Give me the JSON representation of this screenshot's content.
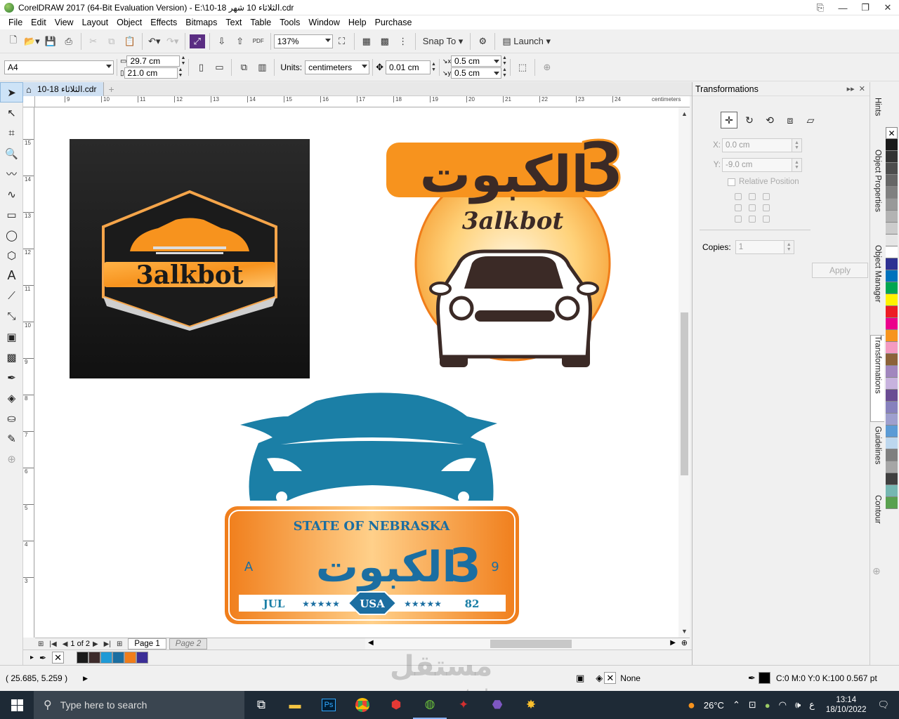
{
  "window": {
    "title": "CorelDRAW 2017 (64-Bit Evaluation Version) - E:\\10-18 الثلاثاء 10 شهر.cdr"
  },
  "menu": [
    "File",
    "Edit",
    "View",
    "Layout",
    "Object",
    "Effects",
    "Bitmaps",
    "Text",
    "Table",
    "Tools",
    "Window",
    "Help",
    "Purchase"
  ],
  "toolbar": {
    "zoom": "137%",
    "snap_to": "Snap To",
    "launch": "Launch"
  },
  "property_bar": {
    "page_size": "A4",
    "width": "29.7 cm",
    "height": "21.0 cm",
    "units_label": "Units:",
    "units": "centimeters",
    "nudge": "0.01 cm",
    "dup_x": "0.5 cm",
    "dup_y": "0.5 cm"
  },
  "document_tab": "10-18 الثلاثاء.cdr",
  "ruler": {
    "h_ticks": [
      "9",
      "10",
      "11",
      "12",
      "13",
      "14",
      "15",
      "16",
      "17",
      "18",
      "19",
      "20",
      "21",
      "22",
      "23",
      "24"
    ],
    "h_unit": "centimeters",
    "v_ticks": [
      "15",
      "14",
      "13",
      "12",
      "11",
      "10",
      "9",
      "8",
      "7",
      "6",
      "5",
      "4",
      "3"
    ]
  },
  "page_nav": {
    "current": "1",
    "of_label": "of",
    "total": "2",
    "tabs": [
      "Page 1",
      "Page 2"
    ]
  },
  "canvas": {
    "logo1": {
      "text": "3alkbot"
    },
    "logo2": {
      "arabic": "الكبوت",
      "digit": "3",
      "latin": "3alkbot"
    },
    "logo3": {
      "state": "STATE OF NEBRASKA",
      "arabic": "الكبوت",
      "digit": "3",
      "left_letter": "A",
      "right_digit": "9",
      "month": "JUL",
      "country": "USA",
      "year": "82",
      "stars": "★★★★★"
    }
  },
  "docker": {
    "title": "Transformations",
    "x_label": "X:",
    "x_value": "0.0 cm",
    "y_label": "Y:",
    "y_value": "-9.0 cm",
    "relative_position": "Relative Position",
    "copies_label": "Copies:",
    "copies_value": "1",
    "apply": "Apply",
    "tabs": [
      "Hints",
      "Object Properties",
      "Object Manager",
      "Transformations",
      "Guidelines",
      "Contour"
    ]
  },
  "palette_colors": [
    "#1a1a1a",
    "#333333",
    "#4d4d4d",
    "#666666",
    "#808080",
    "#999999",
    "#b3b3b3",
    "#cccccc",
    "#e6e6e6",
    "#ffffff",
    "#2e3192",
    "#0072bc",
    "#00a651",
    "#fff200",
    "#ed1c24",
    "#ec008c",
    "#f7941d",
    "#f49ac1",
    "#8c6239",
    "#a186be",
    "#c7b2de",
    "#6a4c93",
    "#8781bd",
    "#9e9fce",
    "#5b9bd5",
    "#bdd7ee",
    "#7f7f7f",
    "#a6a6a6",
    "#3f3f3f",
    "#76b7b2",
    "#59a14f"
  ],
  "doc_palette": [
    "#1a1a1a",
    "#3d2b2b",
    "#1f9ad6",
    "#1b6ea1",
    "#f07d1a",
    "#3b2e96"
  ],
  "status": {
    "coords": "( 25.685, 5.259 )",
    "fill": "None",
    "outline": "C:0 M:0 Y:0 K:100  0.567 pt"
  },
  "watermark": {
    "arabic": "مستقل",
    "latin": "mostaql.com"
  },
  "taskbar": {
    "search_placeholder": "Type here to search",
    "temp": "26°C",
    "lang": "ع",
    "time": "13:14",
    "date": "18/10/2022"
  }
}
